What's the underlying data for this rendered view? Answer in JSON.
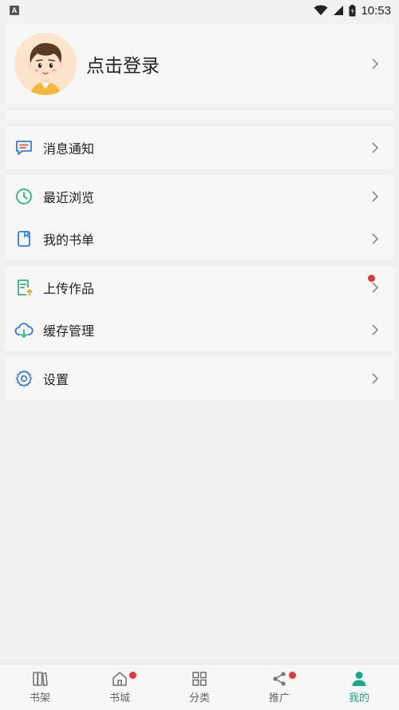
{
  "status_bar": {
    "left_icon_letter": "A",
    "time": "10:53",
    "icons": [
      "wifi-icon",
      "signal-icon",
      "battery-icon"
    ]
  },
  "profile": {
    "login_label": "点击登录",
    "avatar_icon": "boy-avatar-icon"
  },
  "menu_groups": [
    {
      "items": [
        {
          "label": "消息通知",
          "icon": "message-icon"
        }
      ]
    },
    {
      "items": [
        {
          "label": "最近浏览",
          "icon": "clock-icon"
        },
        {
          "label": "我的书单",
          "icon": "bookmark-icon"
        }
      ]
    },
    {
      "items": [
        {
          "label": "上传作品",
          "icon": "upload-doc-icon",
          "badge_dot": true
        },
        {
          "label": "缓存管理",
          "icon": "cloud-download-icon"
        }
      ]
    },
    {
      "items": [
        {
          "label": "设置",
          "icon": "gear-icon"
        }
      ]
    }
  ],
  "tabbar": {
    "tabs": [
      {
        "label": "书架",
        "icon": "bookshelf-icon",
        "active": false,
        "dot": false
      },
      {
        "label": "书城",
        "icon": "home-icon",
        "active": false,
        "dot": true
      },
      {
        "label": "分类",
        "icon": "grid-icon",
        "active": false,
        "dot": false
      },
      {
        "label": "推广",
        "icon": "share-icon",
        "active": false,
        "dot": true
      },
      {
        "label": "我的",
        "icon": "person-icon",
        "active": true,
        "dot": false
      }
    ]
  },
  "colors": {
    "accent": "#17a98a",
    "badge": "#e23a3a",
    "icon_blue": "#2f7de1",
    "icon_green": "#2fb47f",
    "icon_red": "#e2564a"
  }
}
